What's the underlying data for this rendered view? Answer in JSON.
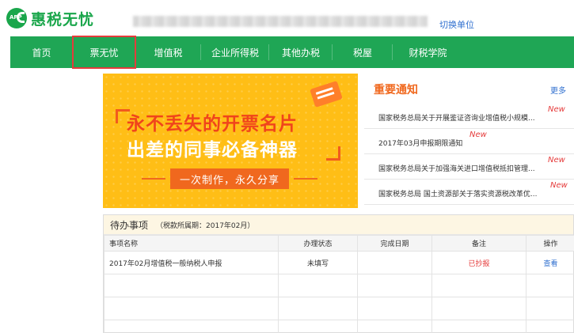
{
  "header": {
    "logo_text": "惠税无忧",
    "logo_mark": "APP",
    "switch_unit": "切换单位"
  },
  "nav": {
    "items": [
      "首页",
      "票无忧",
      "增值税",
      "企业所得税",
      "其他办税",
      "税屋",
      "财税学院"
    ]
  },
  "banner": {
    "line1": "永不丢失的开票名片",
    "line2": "出差的同事必备神器",
    "slogan": "一次制作，永久分享"
  },
  "notice": {
    "title": "重要通知",
    "more": "更多",
    "items": [
      {
        "text": "国家税务总局关于开展鉴证咨询业增值税小规模...",
        "badge": "New"
      },
      {
        "text": "2017年03月申报期限通知",
        "badge": "New"
      },
      {
        "text": "国家税务总局关于加强海关进口增值税抵扣管理...",
        "badge": "New"
      },
      {
        "text": "国家税务总局 国土资源部关于落实资源税改革优...",
        "badge": "New"
      }
    ]
  },
  "todo": {
    "title": "待办事项",
    "period": "（税款所属期：2017年02月）",
    "columns": [
      "事项名称",
      "办理状态",
      "完成日期",
      "备注",
      "操作"
    ],
    "rows": [
      {
        "name": "2017年02月增值税一般纳税人申报",
        "status": "未填写",
        "date": "",
        "note": "已抄报",
        "action": "查看"
      }
    ]
  },
  "colors": {
    "brand_green": "#1fa655",
    "accent_orange": "#f0681e",
    "alert_red": "#e53b3b",
    "link_blue": "#2f6fcf",
    "banner_yellow": "#ffbe16"
  }
}
